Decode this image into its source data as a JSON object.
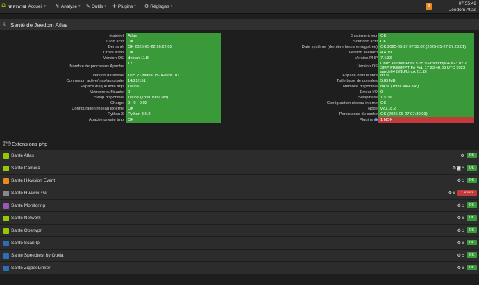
{
  "navbar": {
    "brand": "JEEDOM",
    "menu": [
      {
        "label": "Accueil",
        "icon": "home-icon"
      },
      {
        "label": "Analyse",
        "icon": "analysis-icon"
      },
      {
        "label": "Outils",
        "icon": "tools-icon"
      },
      {
        "label": "Plugins",
        "icon": "puzzle-icon"
      },
      {
        "label": "Réglages",
        "icon": "gears-icon"
      }
    ],
    "notification_count": "2",
    "time": "07:55:49",
    "system_name": "Jeedom Atlas"
  },
  "panel": {
    "title": "Santé de Jeedom Atlas"
  },
  "health": {
    "left": [
      {
        "label": "Matériel",
        "value": "Atlas"
      },
      {
        "label": "Cron actif",
        "value": "OK"
      },
      {
        "label": "Démarré",
        "value": "OK 2025-05-22 16:22:03"
      },
      {
        "label": "Droits sudo",
        "value": "OK"
      },
      {
        "label": "Version OS",
        "value": "debian 11.8"
      },
      {
        "label": "Nombre de processus Apache",
        "value": "12"
      },
      {
        "label": "Version database",
        "value": "10.5.21-MariaDB-0+deb11u1"
      },
      {
        "label": "Connexion active/max/autorisée",
        "value": "14/21/151"
      },
      {
        "label": "Espace disque libre tmp",
        "value": "100 %"
      },
      {
        "label": "Mémoire suffisante",
        "value": "0"
      },
      {
        "label": "Swap disponible",
        "value": "100 % (Total 1932 Mo)"
      },
      {
        "label": "Charge",
        "value": "0 - 0 - 0.02"
      },
      {
        "label": "Configuration réseau externe",
        "value": "OK"
      },
      {
        "label": "Python 3",
        "value": "Python 3.9.2"
      },
      {
        "label": "Apache private tmp",
        "value": "OK"
      }
    ],
    "right": [
      {
        "label": "Système à jour",
        "value": "OK"
      },
      {
        "label": "Scénario actif",
        "value": "OK"
      },
      {
        "label": "Date système (dernière heure enregistrée)",
        "value": "OK 2025-05-27 07:55:02 (2025-05-27 07:23:01)"
      },
      {
        "label": "Version Jeedom",
        "value": "4.4.19"
      },
      {
        "label": "Version PHP",
        "value": "7.4.33"
      },
      {
        "label": "Version OS",
        "value": "Linux JeedomAtlas 5.15.93-rockchip64 #23.02.2 SMP PREEMPT Fri Feb 17 23:48:36 UTC 2023 aarch64 GNU/Linux [11.8]"
      },
      {
        "label": "Espace disque libre",
        "value": "83 %"
      },
      {
        "label": "Taille base de données",
        "value": "5.89 MB"
      },
      {
        "label": "Mémoire disponible",
        "value": "84 % (Total 3864 Mo)"
      },
      {
        "label": "Erreur I/O",
        "value": "0"
      },
      {
        "label": "Swapiness",
        "value": "100 %"
      },
      {
        "label": "Configuration réseau interne",
        "value": "OK"
      },
      {
        "label": "Node",
        "value": "v20.18.2"
      },
      {
        "label": "Persistance du cache",
        "value": "OK (2025-05-27 07:30:03)"
      },
      {
        "label": "Plugins",
        "value": "1 NOK"
      }
    ]
  },
  "extensions": {
    "title": "Extensions php",
    "icon_text": "php",
    "plugins": [
      {
        "name": "Santé Atlas",
        "icon_color": "#94ca02",
        "status": "OK"
      },
      {
        "name": "Santé Caméra",
        "icon_color": "#94ca02",
        "status": "OK"
      },
      {
        "name": "Santé Hikvision Event",
        "icon_color": "#e8891d",
        "status": "OK"
      },
      {
        "name": "Santé Huawei 4G",
        "icon_color": "#888888",
        "status": "1 erreurs"
      },
      {
        "name": "Santé Monitoring",
        "icon_color": "#9b59b6",
        "status": "OK"
      },
      {
        "name": "Santé Network",
        "icon_color": "#94ca02",
        "status": "OK"
      },
      {
        "name": "Santé Openvpn",
        "icon_color": "#94ca02",
        "status": "OK"
      },
      {
        "name": "Santé Scan.Ip",
        "icon_color": "#2c6fb5",
        "status": "OK"
      },
      {
        "name": "Santé Speedtest by Ookla",
        "icon_color": "#2c6fb5",
        "status": "OK"
      },
      {
        "name": "Santé ZigbeeLinker",
        "icon_color": "#2c6fb5",
        "status": "OK"
      }
    ]
  }
}
